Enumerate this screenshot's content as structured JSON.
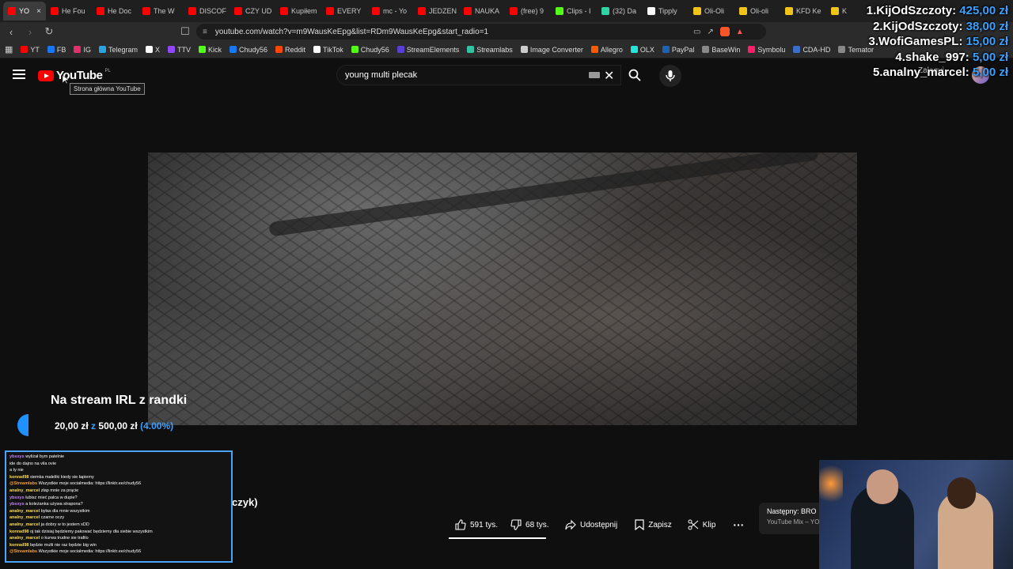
{
  "tabs": [
    {
      "label": "YO",
      "color": "#ff0000",
      "active": true
    },
    {
      "label": "He Fou",
      "color": "#ff0000"
    },
    {
      "label": "He Doc",
      "color": "#ff0000"
    },
    {
      "label": "The W",
      "color": "#ff0000"
    },
    {
      "label": "DISCOF",
      "color": "#ff0000"
    },
    {
      "label": "CZY UD",
      "color": "#ff0000"
    },
    {
      "label": "Kupiłem",
      "color": "#ff0000"
    },
    {
      "label": "EVERY",
      "color": "#ff0000"
    },
    {
      "label": "mc - Yo",
      "color": "#ff0000"
    },
    {
      "label": "JEDZEN",
      "color": "#ff0000"
    },
    {
      "label": "NAUKA",
      "color": "#ff0000"
    },
    {
      "label": "(free) 9",
      "color": "#ff0000"
    },
    {
      "label": "Clips - I",
      "color": "#53fc18"
    },
    {
      "label": "(32) Da",
      "color": "#2fd3a4"
    },
    {
      "label": "Tipply",
      "color": "#ffffff"
    },
    {
      "label": "Oli-Oli",
      "color": "#f0c419"
    },
    {
      "label": "Oli-oli",
      "color": "#f0c419"
    },
    {
      "label": "KFD Ke",
      "color": "#f0c419"
    },
    {
      "label": "K",
      "color": "#f0c419"
    }
  ],
  "address": {
    "url": "youtube.com/watch?v=m9WausKeEpg&list=RDm9WausKeEpg&start_radio=1"
  },
  "bookmarks": [
    {
      "label": "YT",
      "color": "#ff0000"
    },
    {
      "label": "FB",
      "color": "#1877f2"
    },
    {
      "label": "IG",
      "color": "#e1306c"
    },
    {
      "label": "Telegram",
      "color": "#2aa3df"
    },
    {
      "label": "X",
      "color": "#ffffff"
    },
    {
      "label": "TTV",
      "color": "#9146ff"
    },
    {
      "label": "Kick",
      "color": "#53fc18"
    },
    {
      "label": "Chudy56",
      "color": "#1877f2"
    },
    {
      "label": "Reddit",
      "color": "#ff4500"
    },
    {
      "label": "TikTok",
      "color": "#ffffff"
    },
    {
      "label": "Chudy56",
      "color": "#53fc18"
    },
    {
      "label": "StreamElements",
      "color": "#5a3fd6"
    },
    {
      "label": "Streamlabs",
      "color": "#31c3a2"
    },
    {
      "label": "Image Converter",
      "color": "#cccccc"
    },
    {
      "label": "Allegro",
      "color": "#ff5a00"
    },
    {
      "label": "OLX",
      "color": "#23e5db"
    },
    {
      "label": "PayPal",
      "color": "#1d63b5"
    },
    {
      "label": "BaseWin",
      "color": "#888888"
    },
    {
      "label": "Symbolu",
      "color": "#ff1f6a"
    },
    {
      "label": "CDA-HD",
      "color": "#3b6ec6"
    },
    {
      "label": "Temator",
      "color": "#888888"
    }
  ],
  "youtube": {
    "logo_text": "YouTube",
    "region": "PL",
    "tooltip": "Strona główna YouTube",
    "search_value": "young multi plecak",
    "signin_fragment": "Zaloguj"
  },
  "overlay": {
    "goal_title": "Na stream IRL z randki",
    "goal_current": "20,00 zł",
    "goal_sep": "z",
    "goal_target": "500,00 zł",
    "goal_pct": "(4.00%)",
    "leaderboard": [
      {
        "name": "1.KijOdSzczoty:",
        "amount": "425,00 zł"
      },
      {
        "name": "2.KijOdSzczoty:",
        "amount": "38,00 zł"
      },
      {
        "name": "3.WofiGamesPL:",
        "amount": "15,00 zł"
      },
      {
        "name": "4.shake_997:",
        "amount": "5,00 zł"
      },
      {
        "name": "5.analny_marcel:",
        "amount": "5,00 zł"
      }
    ],
    "chat": [
      {
        "user": "ybsxys",
        "msg": "wyliżał bym patelnie",
        "cls": "u2"
      },
      {
        "user": "",
        "msg": "ide do dajno na vila ovie",
        "cls": "u"
      },
      {
        "user": "",
        "msg": "a ty nie",
        "cls": "u"
      },
      {
        "user": "konrad98",
        "msg": "siemka małeliki kiedy sie łapiemy",
        "cls": "u3"
      },
      {
        "user": "@Streamlabs",
        "msg": "Wszystkie moje socialmedia: https://linktr.ee/chudy56",
        "cls": "u"
      },
      {
        "user": "analny_marcel",
        "msg": "złap mnie za prącie",
        "cls": "u3"
      },
      {
        "user": "ybsxys",
        "msg": "lubisz mieć palca w dupie?",
        "cls": "u2"
      },
      {
        "user": "ybsxys",
        "msg": "a koleżanka używa strapona?",
        "cls": "u2"
      },
      {
        "user": "analny_marcel",
        "msg": "byłas dla mnie wszystkim",
        "cls": "u3"
      },
      {
        "user": "analny_marcel",
        "msg": "czarne oczy",
        "cls": "u3"
      },
      {
        "user": "analny_marcel",
        "msg": "ja dobry w to jestem xDD",
        "cls": "u3"
      },
      {
        "user": "konrad98",
        "msg": "oj tak dzisiaj będziemy pakować będziemy dla siebie wszystkim",
        "cls": "u3"
      },
      {
        "user": "analny_marcel",
        "msg": "o kurwa trudne sie trafilo",
        "cls": "u3"
      },
      {
        "user": "konrad98",
        "msg": "będzie multi nie raz będzie big win",
        "cls": "u3"
      },
      {
        "user": "@Streamlabs",
        "msg": "Wszystkie moje socialmedia: https://linktr.ee/chudy56",
        "cls": "u"
      }
    ]
  },
  "below": {
    "title_fragment": "czyk)",
    "like_count": "591 tys.",
    "dislike_count": "68 tys.",
    "share_label": "Udostępnij",
    "save_label": "Zapisz",
    "clip_label": "Klip",
    "next_title": "Następny: BRO",
    "next_sub": "YouTube Mix – YO"
  }
}
